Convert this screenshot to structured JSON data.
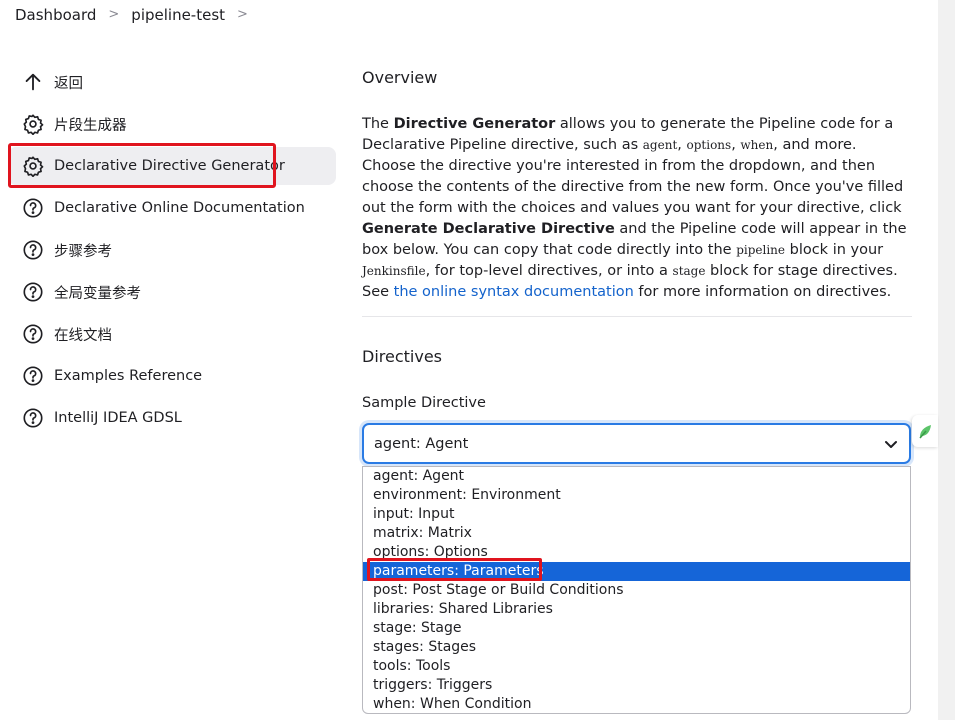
{
  "breadcrumb": {
    "items": [
      "Dashboard",
      "pipeline-test"
    ],
    "separator": ">"
  },
  "sidebar": {
    "items": [
      {
        "label": "返回",
        "icon": "arrow-up-icon"
      },
      {
        "label": "片段生成器",
        "icon": "gear-icon"
      },
      {
        "label": "Declarative Directive Generator",
        "icon": "gear-icon",
        "active": true
      },
      {
        "label": "Declarative Online Documentation",
        "icon": "help-circle-icon"
      },
      {
        "label": "步骤参考",
        "icon": "help-circle-icon"
      },
      {
        "label": "全局变量参考",
        "icon": "help-circle-icon"
      },
      {
        "label": "在线文档",
        "icon": "help-circle-icon"
      },
      {
        "label": "Examples Reference",
        "icon": "help-circle-icon"
      },
      {
        "label": "IntelliJ IDEA GDSL",
        "icon": "help-circle-icon"
      }
    ]
  },
  "overview": {
    "title": "Overview",
    "p1": "The ",
    "b1": "Directive Generator",
    "p2": " allows you to generate the Pipeline code for a Declarative Pipeline directive, such as ",
    "c1": "agent",
    "p3": ", ",
    "c2": "options",
    "p4": ", ",
    "c3": "when",
    "p5": ", and more. Choose the directive you're interested in from the dropdown, and then choose the contents of the directive from the new form. Once you've filled out the form with the choices and values you want for your directive, click ",
    "b2": "Generate Declarative Directive",
    "p6": " and the Pipeline code will appear in the box below. You can copy that code directly into the ",
    "c4": "pipeline",
    "p7": " block in your ",
    "c5": "Jenkinsfile",
    "p8": ", for top-level directives, or into a ",
    "c6": "stage",
    "p9": " block for stage directives. See ",
    "link": "the online syntax documentation",
    "p10": " for more information on directives."
  },
  "directives": {
    "title": "Directives",
    "sample_label": "Sample Directive",
    "selected_value": "agent: Agent",
    "options": [
      "agent: Agent",
      "environment: Environment",
      "input: Input",
      "matrix: Matrix",
      "options: Options",
      "parameters: Parameters",
      "post: Post Stage or Build Conditions",
      "libraries: Shared Libraries",
      "stage: Stage",
      "stages: Stages",
      "tools: Tools",
      "triggers: Triggers",
      "when: When Condition"
    ],
    "highlighted_option": "parameters: Parameters"
  },
  "colors": {
    "accent": "#1565d8",
    "link": "#1463cc",
    "annotation_red": "#e0141e",
    "active_bg": "#eeeef1"
  }
}
